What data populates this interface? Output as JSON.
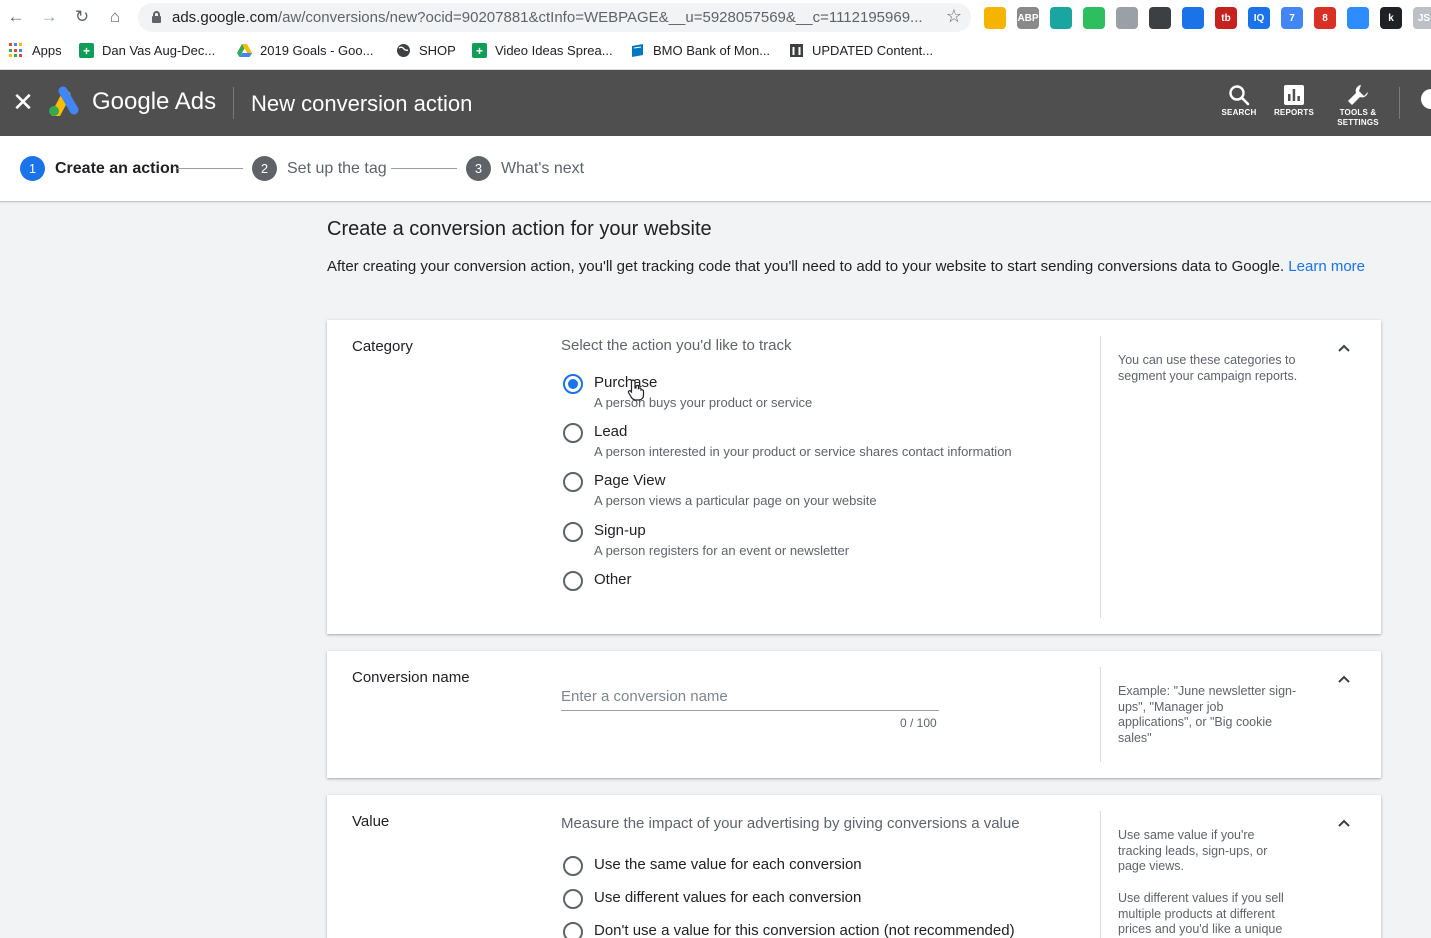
{
  "browser": {
    "url_host": "ads.google.com",
    "url_path": "/aw/conversions/new?ocid=90207881&ctInfo=WEBPAGE&__u=5928057569&__c=1112195969...",
    "extensions": [
      {
        "name": "drive-triangle-icon",
        "text": "",
        "color": "#f4b400"
      },
      {
        "name": "abp-icon",
        "text": "ABP",
        "color": "#8a8a8a"
      },
      {
        "name": "circle-ext-icon",
        "text": "",
        "color": "#1aa6a0"
      },
      {
        "name": "evernote-icon",
        "text": "",
        "color": "#2dbe60"
      },
      {
        "name": "image-ext-icon",
        "text": "",
        "color": "#9aa0a6"
      },
      {
        "name": "pen-ext-icon",
        "text": "",
        "color": "#3c4043"
      },
      {
        "name": "settings-ext-icon",
        "text": "",
        "color": "#1a73e8"
      },
      {
        "name": "tb-ext-icon",
        "text": "tb",
        "color": "#c5221f"
      },
      {
        "name": "iq-ext-icon",
        "text": "IQ",
        "color": "#1a73e8"
      },
      {
        "name": "seven-ext-icon",
        "text": "7",
        "color": "#4285f4"
      },
      {
        "name": "calendar-ext-icon",
        "text": "8",
        "color": "#d93025"
      },
      {
        "name": "zoom-ext-icon",
        "text": "",
        "color": "#2d8cff"
      },
      {
        "name": "k-ext-icon",
        "text": "k",
        "color": "#202124"
      },
      {
        "name": "js-ext-icon",
        "text": "JS",
        "color": "#bdc1c6"
      }
    ]
  },
  "bookmarks": [
    {
      "label": "Apps",
      "icon": "apps-icon",
      "color": "#ea4335"
    },
    {
      "label": "Dan Vas Aug-Dec...",
      "icon": "sheets-icon",
      "color": "#0f9d58"
    },
    {
      "label": "2019 Goals - Goo...",
      "icon": "drive-icon",
      "color": "#f4b400"
    },
    {
      "label": "SHOP",
      "icon": "globe-icon",
      "color": "#3c4043"
    },
    {
      "label": "Video Ideas Sprea...",
      "icon": "sheets-icon",
      "color": "#0f9d58"
    },
    {
      "label": "BMO Bank of Mon...",
      "icon": "bank-icon",
      "color": "#0079c1"
    },
    {
      "label": "UPDATED Content...",
      "icon": "doc-icon",
      "color": "#3c4043"
    }
  ],
  "header": {
    "brand": "Google Ads",
    "title": "New conversion action",
    "tools": {
      "search": "SEARCH",
      "reports": "REPORTS",
      "tools_line1": "TOOLS &",
      "tools_line2": "SETTINGS"
    }
  },
  "stepper": {
    "steps": [
      {
        "num": "1",
        "label": "Create an action"
      },
      {
        "num": "2",
        "label": "Set up the tag"
      },
      {
        "num": "3",
        "label": "What's next"
      }
    ]
  },
  "main": {
    "title": "Create a conversion action for your website",
    "intro": "After creating your conversion action, you'll get tracking code that you'll need to add to your website to start sending conversions data to Google.",
    "learn_more": "Learn more"
  },
  "category": {
    "label": "Category",
    "prompt": "Select the action you'd like to track",
    "help": "You can use these categories to segment your campaign reports.",
    "options": [
      {
        "title": "Purchase",
        "desc": "A person buys your product or service"
      },
      {
        "title": "Lead",
        "desc": "A person interested in your product or service shares contact information"
      },
      {
        "title": "Page View",
        "desc": "A person views a particular page on your website"
      },
      {
        "title": "Sign-up",
        "desc": "A person registers for an event or newsletter"
      },
      {
        "title": "Other",
        "desc": ""
      }
    ],
    "selected": "Purchase"
  },
  "conversion_name": {
    "label": "Conversion name",
    "placeholder": "Enter a conversion name",
    "value": "",
    "count": "0 / 100",
    "help": "Example: \"June newsletter sign-ups\", \"Manager job applications\", or \"Big cookie sales\""
  },
  "value": {
    "label": "Value",
    "prompt": "Measure the impact of your advertising by giving conversions a value",
    "help1": "Use same value if you're tracking leads, sign-ups, or page views.",
    "help2": "Use different values if you sell multiple products at different prices and you'd like a unique",
    "options": [
      {
        "title": "Use the same value for each conversion"
      },
      {
        "title": "Use different values for each conversion"
      },
      {
        "title": "Don't use a value for this conversion action (not recommended)"
      }
    ]
  },
  "colors": {
    "accent": "#1a73e8",
    "header_bg": "#4f4f4f"
  }
}
